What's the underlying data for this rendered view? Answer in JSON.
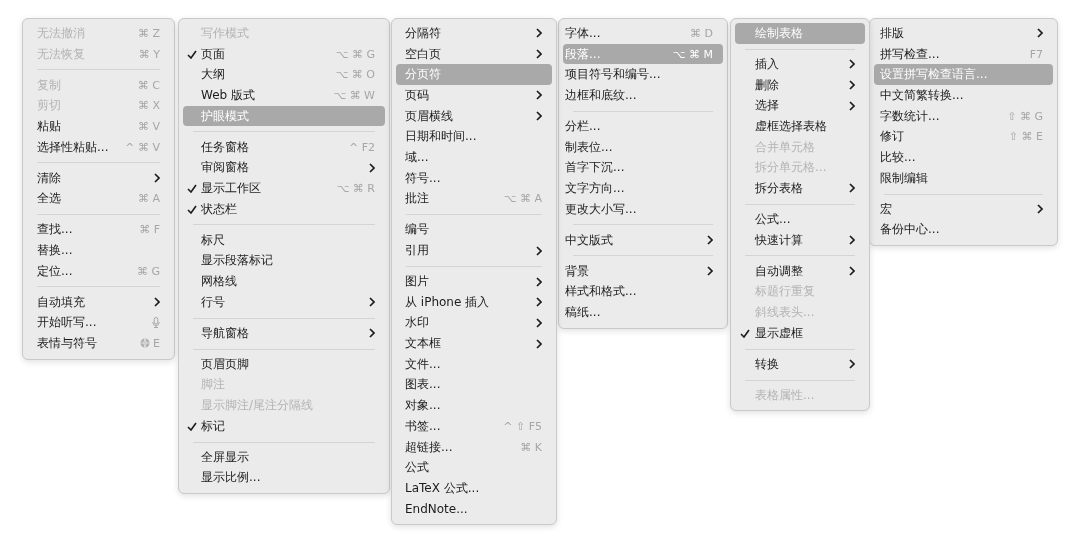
{
  "menus": [
    {
      "items": [
        {
          "kind": "item",
          "label": "无法撤消",
          "shortcut": "⌘ Z",
          "disabled": true,
          "checked": false,
          "selected": false,
          "submenu": false
        },
        {
          "kind": "item",
          "label": "无法恢复",
          "shortcut": "⌘ Y",
          "disabled": true,
          "checked": false,
          "selected": false,
          "submenu": false
        },
        {
          "kind": "separator"
        },
        {
          "kind": "item",
          "label": "复制",
          "shortcut": "⌘ C",
          "disabled": true,
          "checked": false,
          "selected": false,
          "submenu": false
        },
        {
          "kind": "item",
          "label": "剪切",
          "shortcut": "⌘ X",
          "disabled": true,
          "checked": false,
          "selected": false,
          "submenu": false
        },
        {
          "kind": "item",
          "label": "粘贴",
          "shortcut": "⌘ V",
          "disabled": false,
          "checked": false,
          "selected": false,
          "submenu": false
        },
        {
          "kind": "item",
          "label": "选择性粘贴...",
          "shortcut": "^ ⌘ V",
          "disabled": false,
          "checked": false,
          "selected": false,
          "submenu": false
        },
        {
          "kind": "separator"
        },
        {
          "kind": "item",
          "label": "清除",
          "disabled": false,
          "checked": false,
          "selected": false,
          "submenu": true
        },
        {
          "kind": "item",
          "label": "全选",
          "shortcut": "⌘ A",
          "disabled": false,
          "checked": false,
          "selected": false,
          "submenu": false
        },
        {
          "kind": "separator"
        },
        {
          "kind": "item",
          "label": "查找...",
          "shortcut": "⌘ F",
          "disabled": false,
          "checked": false,
          "selected": false,
          "submenu": false
        },
        {
          "kind": "item",
          "label": "替换...",
          "disabled": false,
          "checked": false,
          "selected": false,
          "submenu": false
        },
        {
          "kind": "item",
          "label": "定位...",
          "shortcut": "⌘ G",
          "disabled": false,
          "checked": false,
          "selected": false,
          "submenu": false
        },
        {
          "kind": "separator"
        },
        {
          "kind": "item",
          "label": "自动填充",
          "disabled": false,
          "checked": false,
          "selected": false,
          "submenu": true
        },
        {
          "kind": "dictation",
          "label": "开始听写...",
          "disabled": false,
          "checked": false,
          "selected": false,
          "submenu": false
        },
        {
          "kind": "emoji",
          "label": "表情与符号",
          "shortcut": "E",
          "disabled": false,
          "checked": false,
          "selected": false,
          "submenu": false
        }
      ]
    },
    {
      "items": [
        {
          "kind": "item",
          "label": "写作模式",
          "disabled": true,
          "checked": false,
          "selected": false,
          "submenu": false
        },
        {
          "kind": "item",
          "label": "页面",
          "shortcut": "⌥ ⌘ G",
          "disabled": false,
          "checked": true,
          "selected": false,
          "submenu": false
        },
        {
          "kind": "item",
          "label": "大纲",
          "shortcut": "⌥ ⌘ O",
          "disabled": false,
          "checked": false,
          "selected": false,
          "submenu": false
        },
        {
          "kind": "item",
          "label": "Web 版式",
          "shortcut": "⌥ ⌘ W",
          "disabled": false,
          "checked": false,
          "selected": false,
          "submenu": false
        },
        {
          "kind": "item",
          "label": "护眼模式",
          "disabled": false,
          "checked": false,
          "selected": true,
          "submenu": false
        },
        {
          "kind": "separator"
        },
        {
          "kind": "item",
          "label": "任务窗格",
          "shortcut": "^ F2",
          "disabled": false,
          "checked": false,
          "selected": false,
          "submenu": false
        },
        {
          "kind": "item",
          "label": "审阅窗格",
          "disabled": false,
          "checked": false,
          "selected": false,
          "submenu": true
        },
        {
          "kind": "item",
          "label": "显示工作区",
          "shortcut": "⌥ ⌘ R",
          "disabled": false,
          "checked": true,
          "selected": false,
          "submenu": false
        },
        {
          "kind": "item",
          "label": "状态栏",
          "disabled": false,
          "checked": true,
          "selected": false,
          "submenu": false
        },
        {
          "kind": "separator"
        },
        {
          "kind": "item",
          "label": "标尺",
          "disabled": false,
          "checked": false,
          "selected": false,
          "submenu": false
        },
        {
          "kind": "item",
          "label": "显示段落标记",
          "disabled": false,
          "checked": false,
          "selected": false,
          "submenu": false
        },
        {
          "kind": "item",
          "label": "网格线",
          "disabled": false,
          "checked": false,
          "selected": false,
          "submenu": false
        },
        {
          "kind": "item",
          "label": "行号",
          "disabled": false,
          "checked": false,
          "selected": false,
          "submenu": true
        },
        {
          "kind": "separator"
        },
        {
          "kind": "item",
          "label": "导航窗格",
          "disabled": false,
          "checked": false,
          "selected": false,
          "submenu": true
        },
        {
          "kind": "separator"
        },
        {
          "kind": "item",
          "label": "页眉页脚",
          "disabled": false,
          "checked": false,
          "selected": false,
          "submenu": false
        },
        {
          "kind": "item",
          "label": "脚注",
          "disabled": true,
          "checked": false,
          "selected": false,
          "submenu": false
        },
        {
          "kind": "item",
          "label": "显示脚注/尾注分隔线",
          "disabled": true,
          "checked": false,
          "selected": false,
          "submenu": false
        },
        {
          "kind": "item",
          "label": "标记",
          "disabled": false,
          "checked": true,
          "selected": false,
          "submenu": false
        },
        {
          "kind": "separator"
        },
        {
          "kind": "item",
          "label": "全屏显示",
          "disabled": false,
          "checked": false,
          "selected": false,
          "submenu": false
        },
        {
          "kind": "item",
          "label": "显示比例...",
          "disabled": false,
          "checked": false,
          "selected": false,
          "submenu": false
        }
      ]
    },
    {
      "items": [
        {
          "kind": "item",
          "label": "分隔符",
          "disabled": false,
          "checked": false,
          "selected": false,
          "submenu": true
        },
        {
          "kind": "item",
          "label": "空白页",
          "disabled": false,
          "checked": false,
          "selected": false,
          "submenu": true
        },
        {
          "kind": "item",
          "label": "分页符",
          "disabled": false,
          "checked": false,
          "selected": true,
          "submenu": false
        },
        {
          "kind": "item",
          "label": "页码",
          "disabled": false,
          "checked": false,
          "selected": false,
          "submenu": true
        },
        {
          "kind": "item",
          "label": "页眉横线",
          "disabled": false,
          "checked": false,
          "selected": false,
          "submenu": true
        },
        {
          "kind": "item",
          "label": "日期和时间...",
          "disabled": false,
          "checked": false,
          "selected": false,
          "submenu": false
        },
        {
          "kind": "item",
          "label": "域...",
          "disabled": false,
          "checked": false,
          "selected": false,
          "submenu": false
        },
        {
          "kind": "item",
          "label": "符号...",
          "disabled": false,
          "checked": false,
          "selected": false,
          "submenu": false
        },
        {
          "kind": "item",
          "label": "批注",
          "shortcut": "⌥ ⌘ A",
          "disabled": false,
          "checked": false,
          "selected": false,
          "submenu": false
        },
        {
          "kind": "separator"
        },
        {
          "kind": "item",
          "label": "编号",
          "disabled": false,
          "checked": false,
          "selected": false,
          "submenu": false
        },
        {
          "kind": "item",
          "label": "引用",
          "disabled": false,
          "checked": false,
          "selected": false,
          "submenu": true
        },
        {
          "kind": "separator"
        },
        {
          "kind": "item",
          "label": "图片",
          "disabled": false,
          "checked": false,
          "selected": false,
          "submenu": true
        },
        {
          "kind": "item",
          "label": "从 iPhone 插入",
          "disabled": false,
          "checked": false,
          "selected": false,
          "submenu": true
        },
        {
          "kind": "item",
          "label": "水印",
          "disabled": false,
          "checked": false,
          "selected": false,
          "submenu": true
        },
        {
          "kind": "item",
          "label": "文本框",
          "disabled": false,
          "checked": false,
          "selected": false,
          "submenu": true
        },
        {
          "kind": "item",
          "label": "文件...",
          "disabled": false,
          "checked": false,
          "selected": false,
          "submenu": false
        },
        {
          "kind": "item",
          "label": "图表...",
          "disabled": false,
          "checked": false,
          "selected": false,
          "submenu": false
        },
        {
          "kind": "item",
          "label": "对象...",
          "disabled": false,
          "checked": false,
          "selected": false,
          "submenu": false
        },
        {
          "kind": "item",
          "label": "书签...",
          "shortcut": "^ ⇧ F5",
          "disabled": false,
          "checked": false,
          "selected": false,
          "submenu": false
        },
        {
          "kind": "item",
          "label": "超链接...",
          "shortcut": "⌘ K",
          "disabled": false,
          "checked": false,
          "selected": false,
          "submenu": false
        },
        {
          "kind": "item",
          "label": "公式",
          "disabled": false,
          "checked": false,
          "selected": false,
          "submenu": false
        },
        {
          "kind": "item",
          "label": "LaTeX 公式...",
          "disabled": false,
          "checked": false,
          "selected": false,
          "submenu": false
        },
        {
          "kind": "item",
          "label": "EndNote...",
          "disabled": false,
          "checked": false,
          "selected": false,
          "submenu": false
        }
      ]
    },
    {
      "items": [
        {
          "kind": "item",
          "label": "字体...",
          "shortcut": "⌘ D",
          "disabled": false,
          "checked": false,
          "selected": false,
          "submenu": false
        },
        {
          "kind": "item",
          "label": "段落...",
          "shortcut": "⌥ ⌘ M",
          "disabled": false,
          "checked": false,
          "selected": true,
          "submenu": false
        },
        {
          "kind": "item",
          "label": "项目符号和编号...",
          "disabled": false,
          "checked": false,
          "selected": false,
          "submenu": false
        },
        {
          "kind": "item",
          "label": "边框和底纹...",
          "disabled": false,
          "checked": false,
          "selected": false,
          "submenu": false
        },
        {
          "kind": "separator"
        },
        {
          "kind": "item",
          "label": "分栏...",
          "disabled": false,
          "checked": false,
          "selected": false,
          "submenu": false
        },
        {
          "kind": "item",
          "label": "制表位...",
          "disabled": false,
          "checked": false,
          "selected": false,
          "submenu": false
        },
        {
          "kind": "item",
          "label": "首字下沉...",
          "disabled": false,
          "checked": false,
          "selected": false,
          "submenu": false
        },
        {
          "kind": "item",
          "label": "文字方向...",
          "disabled": false,
          "checked": false,
          "selected": false,
          "submenu": false
        },
        {
          "kind": "item",
          "label": "更改大小写...",
          "disabled": false,
          "checked": false,
          "selected": false,
          "submenu": false
        },
        {
          "kind": "separator"
        },
        {
          "kind": "item",
          "label": "中文版式",
          "disabled": false,
          "checked": false,
          "selected": false,
          "submenu": true
        },
        {
          "kind": "separator"
        },
        {
          "kind": "item",
          "label": "背景",
          "disabled": false,
          "checked": false,
          "selected": false,
          "submenu": true
        },
        {
          "kind": "item",
          "label": "样式和格式...",
          "disabled": false,
          "checked": false,
          "selected": false,
          "submenu": false
        },
        {
          "kind": "item",
          "label": "稿纸...",
          "disabled": false,
          "checked": false,
          "selected": false,
          "submenu": false
        }
      ]
    },
    {
      "items": [
        {
          "kind": "item",
          "label": "绘制表格",
          "disabled": false,
          "checked": false,
          "selected": true,
          "submenu": false
        },
        {
          "kind": "separator"
        },
        {
          "kind": "item",
          "label": "插入",
          "disabled": false,
          "checked": false,
          "selected": false,
          "submenu": true
        },
        {
          "kind": "item",
          "label": "删除",
          "disabled": false,
          "checked": false,
          "selected": false,
          "submenu": true
        },
        {
          "kind": "item",
          "label": "选择",
          "disabled": false,
          "checked": false,
          "selected": false,
          "submenu": true
        },
        {
          "kind": "item",
          "label": "虚框选择表格",
          "disabled": false,
          "checked": false,
          "selected": false,
          "submenu": false
        },
        {
          "kind": "item",
          "label": "合并单元格",
          "disabled": true,
          "checked": false,
          "selected": false,
          "submenu": false
        },
        {
          "kind": "item",
          "label": "拆分单元格...",
          "disabled": true,
          "checked": false,
          "selected": false,
          "submenu": false
        },
        {
          "kind": "item",
          "label": "拆分表格",
          "disabled": false,
          "checked": false,
          "selected": false,
          "submenu": true
        },
        {
          "kind": "separator"
        },
        {
          "kind": "item",
          "label": "公式...",
          "disabled": false,
          "checked": false,
          "selected": false,
          "submenu": false
        },
        {
          "kind": "item",
          "label": "快速计算",
          "disabled": false,
          "checked": false,
          "selected": false,
          "submenu": true
        },
        {
          "kind": "separator"
        },
        {
          "kind": "item",
          "label": "自动调整",
          "disabled": false,
          "checked": false,
          "selected": false,
          "submenu": true
        },
        {
          "kind": "item",
          "label": "标题行重复",
          "disabled": true,
          "checked": false,
          "selected": false,
          "submenu": false
        },
        {
          "kind": "item",
          "label": "斜线表头...",
          "disabled": true,
          "checked": false,
          "selected": false,
          "submenu": false
        },
        {
          "kind": "item",
          "label": "显示虚框",
          "disabled": false,
          "checked": true,
          "selected": false,
          "submenu": false
        },
        {
          "kind": "separator"
        },
        {
          "kind": "item",
          "label": "转换",
          "disabled": false,
          "checked": false,
          "selected": false,
          "submenu": true
        },
        {
          "kind": "separator"
        },
        {
          "kind": "item",
          "label": "表格属性...",
          "disabled": true,
          "checked": false,
          "selected": false,
          "submenu": false
        }
      ]
    },
    {
      "items": [
        {
          "kind": "item",
          "label": "排版",
          "disabled": false,
          "checked": false,
          "selected": false,
          "submenu": true
        },
        {
          "kind": "item",
          "label": "拼写检查...",
          "shortcut": "F7",
          "disabled": false,
          "checked": false,
          "selected": false,
          "submenu": false
        },
        {
          "kind": "item",
          "label": "设置拼写检查语言...",
          "disabled": false,
          "checked": false,
          "selected": true,
          "submenu": false
        },
        {
          "kind": "item",
          "label": "中文简繁转换...",
          "disabled": false,
          "checked": false,
          "selected": false,
          "submenu": false
        },
        {
          "kind": "item",
          "label": "字数统计...",
          "shortcut": "⇧ ⌘ G",
          "disabled": false,
          "checked": false,
          "selected": false,
          "submenu": false
        },
        {
          "kind": "item",
          "label": "修订",
          "shortcut": "⇧ ⌘ E",
          "disabled": false,
          "checked": false,
          "selected": false,
          "submenu": false
        },
        {
          "kind": "item",
          "label": "比较...",
          "disabled": false,
          "checked": false,
          "selected": false,
          "submenu": false
        },
        {
          "kind": "item",
          "label": "限制编辑",
          "disabled": false,
          "checked": false,
          "selected": false,
          "submenu": false
        },
        {
          "kind": "separator"
        },
        {
          "kind": "item",
          "label": "宏",
          "disabled": false,
          "checked": false,
          "selected": false,
          "submenu": true
        },
        {
          "kind": "item",
          "label": "备份中心...",
          "disabled": false,
          "checked": false,
          "selected": false,
          "submenu": false
        }
      ]
    }
  ]
}
